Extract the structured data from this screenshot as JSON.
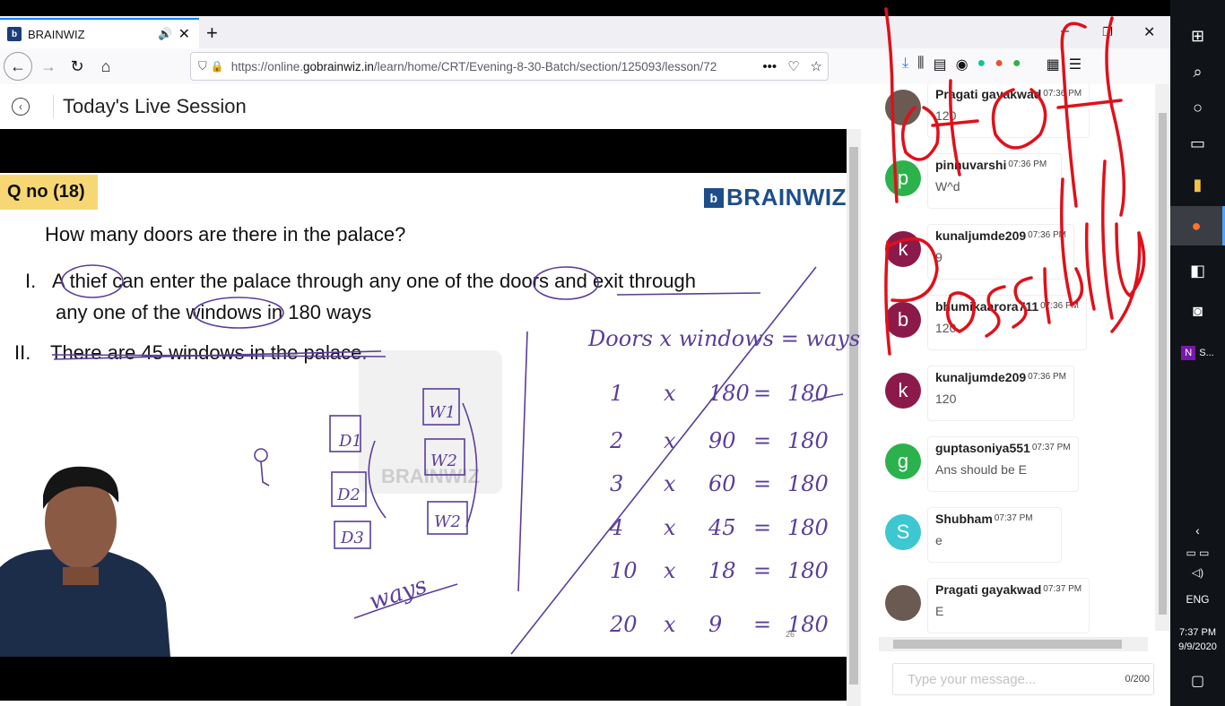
{
  "browser": {
    "tab_title": "BRAINWIZ",
    "tab_favicon": "b",
    "url_prefix": "https://online.",
    "url_domain": "gobrainwiz.in",
    "url_path": "/learn/home/CRT/Evening-8-30-Batch/section/125093/lesson/72",
    "more_label": "•••"
  },
  "page": {
    "session_title": "Today's Live Session"
  },
  "slide": {
    "qno": "Q no (18)",
    "brand": "BRAINWIZ",
    "question": "How many doors are there in the palace?",
    "s1_label": "I.",
    "s1_line1": "A thief can enter the palace through any one of the doors and exit through",
    "s1_line2": "any one of the windows in 180 ways",
    "s2_label": "II.",
    "s2_text": "There are 45 windows in the palace.",
    "watermark": "BRAINWIZ",
    "page_number": "26"
  },
  "chat": {
    "messages": [
      {
        "name": "Pragati gayakwad",
        "time": "07:36 PM",
        "text": "120",
        "initial": "",
        "color": "#6b5a52"
      },
      {
        "name": "pinnuvarshi",
        "time": "07:36 PM",
        "text": "W^d",
        "initial": "p",
        "color": "#2bb24c"
      },
      {
        "name": "kunaljumde209",
        "time": "07:36 PM",
        "text": "9",
        "initial": "k",
        "color": "#8b1a4a"
      },
      {
        "name": "bhumikaarora711",
        "time": "07:36 PM",
        "text": "120",
        "initial": "b",
        "color": "#8b1a4a"
      },
      {
        "name": "kunaljumde209",
        "time": "07:36 PM",
        "text": "120",
        "initial": "k",
        "color": "#8b1a4a"
      },
      {
        "name": "guptasoniya551",
        "time": "07:37 PM",
        "text": "Ans should be E",
        "initial": "g",
        "color": "#2bb24c"
      },
      {
        "name": "Shubham",
        "time": "07:37 PM",
        "text": "e",
        "initial": "S",
        "color": "#3cc7d1"
      },
      {
        "name": "Pragati gayakwad",
        "time": "07:37 PM",
        "text": "E",
        "initial": "",
        "color": "#6b5a52"
      }
    ],
    "input_placeholder": "Type your message...",
    "counter": "0/200"
  },
  "taskbar": {
    "language": "ENG",
    "time": "7:37 PM",
    "date": "9/9/2020",
    "onenote_label": "S..."
  },
  "annotations": {
    "overlay_text": "lot of possibility",
    "board_header": "Doors x windows = ways",
    "board_rows": [
      {
        "d": "1",
        "w": "180",
        "r": "180"
      },
      {
        "d": "2",
        "w": "90",
        "r": "180"
      },
      {
        "d": "3",
        "w": "60",
        "r": "180"
      },
      {
        "d": "4",
        "w": "45",
        "r": "180"
      },
      {
        "d": "10",
        "w": "18",
        "r": "180"
      },
      {
        "d": "20",
        "w": "9",
        "r": "180"
      }
    ],
    "doors": [
      "D1",
      "D2",
      "D3"
    ],
    "windows": [
      "W1",
      "W2",
      "W2"
    ],
    "ways": "ways"
  },
  "colors": {
    "accent": "#0a84ff",
    "brand": "#1d4e89",
    "qno_bg": "#f7d774",
    "ink_purple": "#5a3d9a",
    "ink_red": "#e0101a"
  }
}
